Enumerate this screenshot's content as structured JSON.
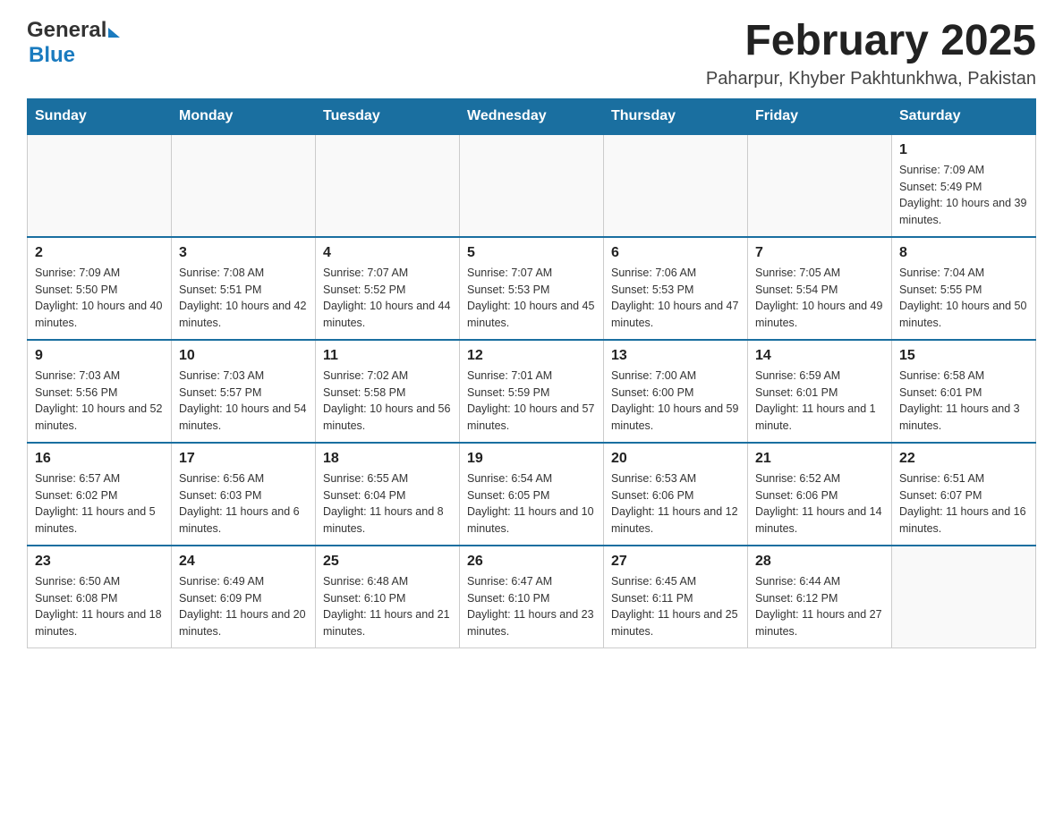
{
  "header": {
    "logo_general": "General",
    "logo_blue": "Blue",
    "title": "February 2025",
    "subtitle": "Paharpur, Khyber Pakhtunkhwa, Pakistan"
  },
  "weekdays": [
    "Sunday",
    "Monday",
    "Tuesday",
    "Wednesday",
    "Thursday",
    "Friday",
    "Saturday"
  ],
  "weeks": [
    [
      {
        "day": "",
        "sunrise": "",
        "sunset": "",
        "daylight": ""
      },
      {
        "day": "",
        "sunrise": "",
        "sunset": "",
        "daylight": ""
      },
      {
        "day": "",
        "sunrise": "",
        "sunset": "",
        "daylight": ""
      },
      {
        "day": "",
        "sunrise": "",
        "sunset": "",
        "daylight": ""
      },
      {
        "day": "",
        "sunrise": "",
        "sunset": "",
        "daylight": ""
      },
      {
        "day": "",
        "sunrise": "",
        "sunset": "",
        "daylight": ""
      },
      {
        "day": "1",
        "sunrise": "Sunrise: 7:09 AM",
        "sunset": "Sunset: 5:49 PM",
        "daylight": "Daylight: 10 hours and 39 minutes."
      }
    ],
    [
      {
        "day": "2",
        "sunrise": "Sunrise: 7:09 AM",
        "sunset": "Sunset: 5:50 PM",
        "daylight": "Daylight: 10 hours and 40 minutes."
      },
      {
        "day": "3",
        "sunrise": "Sunrise: 7:08 AM",
        "sunset": "Sunset: 5:51 PM",
        "daylight": "Daylight: 10 hours and 42 minutes."
      },
      {
        "day": "4",
        "sunrise": "Sunrise: 7:07 AM",
        "sunset": "Sunset: 5:52 PM",
        "daylight": "Daylight: 10 hours and 44 minutes."
      },
      {
        "day": "5",
        "sunrise": "Sunrise: 7:07 AM",
        "sunset": "Sunset: 5:53 PM",
        "daylight": "Daylight: 10 hours and 45 minutes."
      },
      {
        "day": "6",
        "sunrise": "Sunrise: 7:06 AM",
        "sunset": "Sunset: 5:53 PM",
        "daylight": "Daylight: 10 hours and 47 minutes."
      },
      {
        "day": "7",
        "sunrise": "Sunrise: 7:05 AM",
        "sunset": "Sunset: 5:54 PM",
        "daylight": "Daylight: 10 hours and 49 minutes."
      },
      {
        "day": "8",
        "sunrise": "Sunrise: 7:04 AM",
        "sunset": "Sunset: 5:55 PM",
        "daylight": "Daylight: 10 hours and 50 minutes."
      }
    ],
    [
      {
        "day": "9",
        "sunrise": "Sunrise: 7:03 AM",
        "sunset": "Sunset: 5:56 PM",
        "daylight": "Daylight: 10 hours and 52 minutes."
      },
      {
        "day": "10",
        "sunrise": "Sunrise: 7:03 AM",
        "sunset": "Sunset: 5:57 PM",
        "daylight": "Daylight: 10 hours and 54 minutes."
      },
      {
        "day": "11",
        "sunrise": "Sunrise: 7:02 AM",
        "sunset": "Sunset: 5:58 PM",
        "daylight": "Daylight: 10 hours and 56 minutes."
      },
      {
        "day": "12",
        "sunrise": "Sunrise: 7:01 AM",
        "sunset": "Sunset: 5:59 PM",
        "daylight": "Daylight: 10 hours and 57 minutes."
      },
      {
        "day": "13",
        "sunrise": "Sunrise: 7:00 AM",
        "sunset": "Sunset: 6:00 PM",
        "daylight": "Daylight: 10 hours and 59 minutes."
      },
      {
        "day": "14",
        "sunrise": "Sunrise: 6:59 AM",
        "sunset": "Sunset: 6:01 PM",
        "daylight": "Daylight: 11 hours and 1 minute."
      },
      {
        "day": "15",
        "sunrise": "Sunrise: 6:58 AM",
        "sunset": "Sunset: 6:01 PM",
        "daylight": "Daylight: 11 hours and 3 minutes."
      }
    ],
    [
      {
        "day": "16",
        "sunrise": "Sunrise: 6:57 AM",
        "sunset": "Sunset: 6:02 PM",
        "daylight": "Daylight: 11 hours and 5 minutes."
      },
      {
        "day": "17",
        "sunrise": "Sunrise: 6:56 AM",
        "sunset": "Sunset: 6:03 PM",
        "daylight": "Daylight: 11 hours and 6 minutes."
      },
      {
        "day": "18",
        "sunrise": "Sunrise: 6:55 AM",
        "sunset": "Sunset: 6:04 PM",
        "daylight": "Daylight: 11 hours and 8 minutes."
      },
      {
        "day": "19",
        "sunrise": "Sunrise: 6:54 AM",
        "sunset": "Sunset: 6:05 PM",
        "daylight": "Daylight: 11 hours and 10 minutes."
      },
      {
        "day": "20",
        "sunrise": "Sunrise: 6:53 AM",
        "sunset": "Sunset: 6:06 PM",
        "daylight": "Daylight: 11 hours and 12 minutes."
      },
      {
        "day": "21",
        "sunrise": "Sunrise: 6:52 AM",
        "sunset": "Sunset: 6:06 PM",
        "daylight": "Daylight: 11 hours and 14 minutes."
      },
      {
        "day": "22",
        "sunrise": "Sunrise: 6:51 AM",
        "sunset": "Sunset: 6:07 PM",
        "daylight": "Daylight: 11 hours and 16 minutes."
      }
    ],
    [
      {
        "day": "23",
        "sunrise": "Sunrise: 6:50 AM",
        "sunset": "Sunset: 6:08 PM",
        "daylight": "Daylight: 11 hours and 18 minutes."
      },
      {
        "day": "24",
        "sunrise": "Sunrise: 6:49 AM",
        "sunset": "Sunset: 6:09 PM",
        "daylight": "Daylight: 11 hours and 20 minutes."
      },
      {
        "day": "25",
        "sunrise": "Sunrise: 6:48 AM",
        "sunset": "Sunset: 6:10 PM",
        "daylight": "Daylight: 11 hours and 21 minutes."
      },
      {
        "day": "26",
        "sunrise": "Sunrise: 6:47 AM",
        "sunset": "Sunset: 6:10 PM",
        "daylight": "Daylight: 11 hours and 23 minutes."
      },
      {
        "day": "27",
        "sunrise": "Sunrise: 6:45 AM",
        "sunset": "Sunset: 6:11 PM",
        "daylight": "Daylight: 11 hours and 25 minutes."
      },
      {
        "day": "28",
        "sunrise": "Sunrise: 6:44 AM",
        "sunset": "Sunset: 6:12 PM",
        "daylight": "Daylight: 11 hours and 27 minutes."
      },
      {
        "day": "",
        "sunrise": "",
        "sunset": "",
        "daylight": ""
      }
    ]
  ]
}
